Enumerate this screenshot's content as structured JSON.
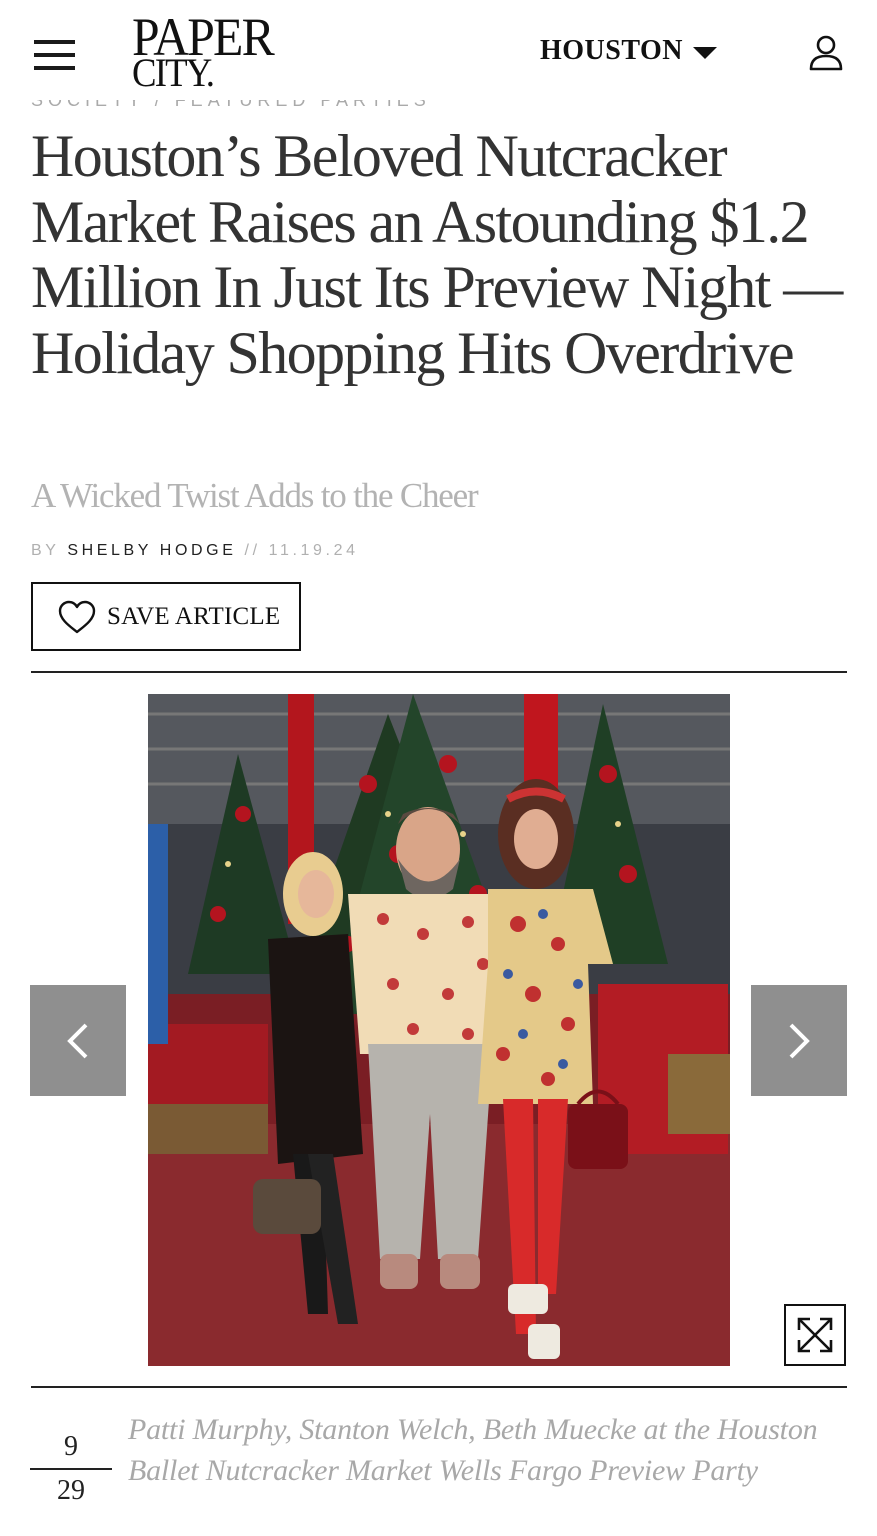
{
  "header": {
    "menu_icon": "hamburger-menu-icon",
    "logo_line1": "PAPER",
    "logo_line2": "CITY.",
    "city_selector": "HOUSTON",
    "city_caret_icon": "caret-down-icon",
    "account_icon": "user-icon"
  },
  "article": {
    "kicker": "SOCIETY / FEATURED PARTIES",
    "headline": "Houston’s Beloved Nutcracker Market Raises an Astounding $1.2 Million In Just Its Preview Night — Holiday Shopping Hits Overdrive",
    "subhead": "A Wicked Twist Adds to the Cheer",
    "byline_prefix": "BY",
    "author": "SHELBY HODGE",
    "date_sep": "//",
    "date": "11.19.24",
    "save_label": "SAVE ARTICLE",
    "save_icon": "heart-outline-icon"
  },
  "gallery": {
    "prev_icon": "chevron-left-icon",
    "next_icon": "chevron-right-icon",
    "expand_icon": "expand-arrows-icon",
    "current": "9",
    "total": "29",
    "caption": "Patti Murphy, Stanton Welch, Beth Muecke at the Houston Ballet Nutcracker Market Wells Fargo Preview Party"
  },
  "colors": {
    "headline": "#333333",
    "subhead": "#b3b3b3",
    "byline_gray": "#b0b0b0",
    "nav_button": "#8f8f8f",
    "caption": "#a8a8a8"
  }
}
